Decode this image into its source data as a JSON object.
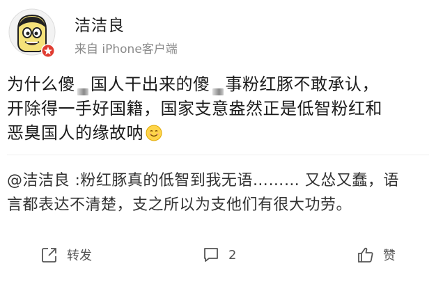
{
  "post": {
    "author": "洁洁良",
    "source": "来自 iPhone客户端",
    "body_lines": [
      [
        "为什么傻",
        "国人干出来的傻",
        "事粉红豚不敢承认，"
      ],
      [
        "开除得一手好国籍，国家支意盎然正是低智粉红和"
      ],
      [
        "恶臭国人的缘故呐"
      ]
    ],
    "emoji_icon": "smile-emoji-icon"
  },
  "repost": {
    "lines": [
      "@洁洁良 :粉红豚真的低智到我无语……… 又怂又蠢，语",
      "言都表达不清楚，支之所以为支他们有很大功劳。"
    ]
  },
  "actions": {
    "forward_label": "转发",
    "comment_count": "2",
    "like_label": "赞"
  },
  "colors": {
    "text": "#1b1b1b",
    "muted": "#8a8a8a",
    "badge": "#e03c31",
    "avatar_ring": "#e6e6e6"
  }
}
